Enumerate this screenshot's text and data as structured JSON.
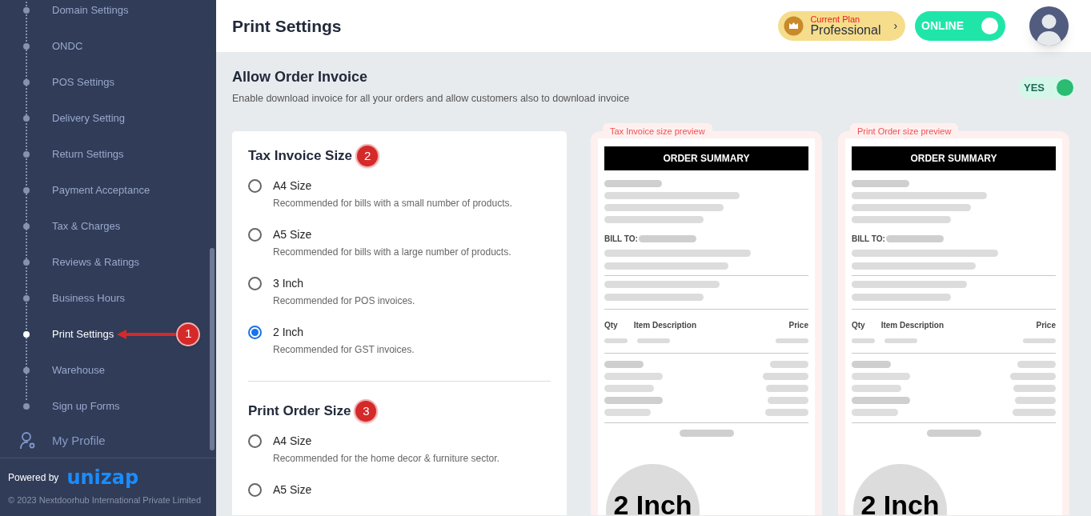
{
  "sidebar": {
    "items": [
      {
        "label": "Domain Settings",
        "selected": false
      },
      {
        "label": "ONDC",
        "selected": false
      },
      {
        "label": "POS Settings",
        "selected": false
      },
      {
        "label": "Delivery Setting",
        "selected": false
      },
      {
        "label": "Return Settings",
        "selected": false
      },
      {
        "label": "Payment Acceptance",
        "selected": false
      },
      {
        "label": "Tax & Charges",
        "selected": false
      },
      {
        "label": "Reviews & Ratings",
        "selected": false
      },
      {
        "label": "Business Hours",
        "selected": false
      },
      {
        "label": "Print Settings",
        "selected": true,
        "annotation": "1"
      },
      {
        "label": "Warehouse",
        "selected": false
      },
      {
        "label": "Sign up Forms",
        "selected": false
      }
    ],
    "profile": "My Profile",
    "powered_by": "Powered by",
    "brand": "unizap",
    "copyright": "© 2023 Nextdoorhub International Private Limited"
  },
  "header": {
    "title": "Print Settings",
    "plan_label": "Current Plan",
    "plan_name": "Professional",
    "plan_chevron": "›",
    "online": {
      "label": "ONLINE",
      "on": true
    }
  },
  "invoice_toggle": {
    "title": "Allow Order Invoice",
    "description": "Enable download invoice for all your orders and allow customers also to download invoice",
    "label": "YES",
    "on": true
  },
  "sections": [
    {
      "title": "Tax Invoice Size",
      "annotation": "2",
      "options": [
        {
          "label": "A4 Size",
          "description": "Recommended for bills with a small number of products.",
          "selected": false
        },
        {
          "label": "A5 Size",
          "description": "Recommended for bills with a large number of products.",
          "selected": false
        },
        {
          "label": "3 Inch",
          "description": "Recommended for POS invoices.",
          "selected": false
        },
        {
          "label": "2 Inch",
          "description": "Recommended for GST invoices.",
          "selected": true
        }
      ]
    },
    {
      "title": "Print Order Size",
      "annotation": "3",
      "options": [
        {
          "label": "A4 Size",
          "description": "Recommended for the home decor & furniture sector.",
          "selected": false
        },
        {
          "label": "A5 Size",
          "selected": false
        }
      ]
    }
  ],
  "previews": [
    {
      "tab": "Tax Invoice size preview",
      "heading": "ORDER SUMMARY",
      "bill_to": "BILL TO:",
      "columns": [
        "Qty",
        "Item Description",
        "Price"
      ],
      "size": "2 Inch"
    },
    {
      "tab": "Print Order size preview",
      "heading": "ORDER SUMMARY",
      "bill_to": "BILL TO:",
      "columns": [
        "Qty",
        "Item Description",
        "Price"
      ],
      "size": "2 Inch"
    }
  ]
}
